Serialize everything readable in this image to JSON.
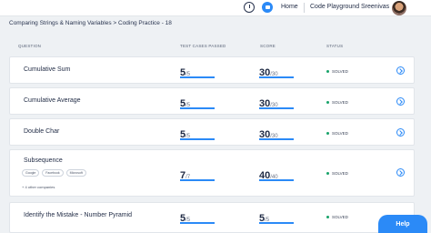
{
  "nav": {
    "home": "Home",
    "code_playground": "Code Playground",
    "user": "Sreenivas"
  },
  "breadcrumb": "Comparing Strings & Naming Variables > Coding Practice - 18",
  "columns": {
    "question": "QUESTION",
    "test_cases": "TEST CASES PASSED",
    "score": "SCORE",
    "status": "STATUS"
  },
  "rows": [
    {
      "title": "Cumulative Sum",
      "passed": "5",
      "total_cases": "/5",
      "score": "30",
      "max_score": "/30",
      "progress": 1.0,
      "status": "SOLVED"
    },
    {
      "title": "Cumulative Average",
      "passed": "5",
      "total_cases": "/5",
      "score": "30",
      "max_score": "/30",
      "progress": 1.0,
      "status": "SOLVED"
    },
    {
      "title": "Double Char",
      "passed": "5",
      "total_cases": "/5",
      "score": "30",
      "max_score": "/30",
      "progress": 1.0,
      "status": "SOLVED"
    },
    {
      "title": "Subsequence",
      "passed": "7",
      "total_cases": "/7",
      "score": "40",
      "max_score": "/40",
      "progress": 1.0,
      "status": "SOLVED",
      "tags": [
        "Google",
        "Facebook",
        "Microsoft"
      ],
      "more": "+ 4 other companies"
    },
    {
      "title": "Identify the Mistake - Number Pyramid",
      "passed": "5",
      "total_cases": "/5",
      "score": "5",
      "max_score": "/5",
      "progress": 1.0,
      "status": "SOLVED"
    }
  ],
  "help": "Help",
  "colors": {
    "accent": "#2b8af7",
    "solved": "#18a36a"
  },
  "icons": {
    "timer": "timer-icon",
    "chat": "chat-icon",
    "row_action": "arrow-right-circle-icon"
  }
}
